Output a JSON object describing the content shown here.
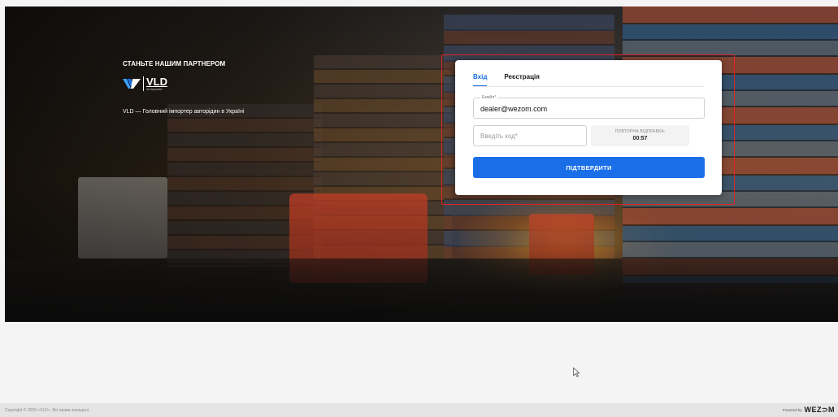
{
  "hero": {
    "partner_title": "СТАНЬТЕ НАШИМ ПАРТНЕРОМ",
    "logo_text": "VLD",
    "logo_subtext": "oil importer",
    "tagline": "VLD — Головний імпортер авторідин в Україні"
  },
  "login": {
    "tabs": [
      {
        "label": "Вхід",
        "active": true
      },
      {
        "label": "Реєстрація",
        "active": false
      }
    ],
    "email_label": "Емейл*",
    "email_value": "dealer@wezom.com",
    "code_placeholder": "Введіть код*",
    "resend_label": "ПОВТОРНА ВІДПРАВКА:",
    "resend_timer": "00:57",
    "submit_label": "ПІДТВЕРДИТИ"
  },
  "footer": {
    "copyright": "Copyright © 2026 «VLD». Всі права захищені.",
    "powered_label": "Powered by",
    "powered_brand": "WEZ⊃M"
  },
  "colors": {
    "accent": "#1a6fe8",
    "highlight": "#e02424"
  }
}
